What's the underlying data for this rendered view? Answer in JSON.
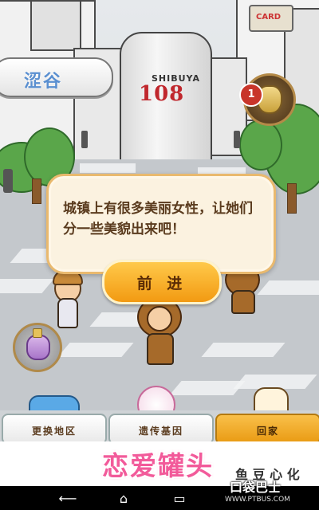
{
  "location": {
    "area_name": "涩谷"
  },
  "scene": {
    "tower_subtitle": "SHIBUYA",
    "tower_number": "108",
    "sign_text": "CARD"
  },
  "item": {
    "count": "1"
  },
  "dialog": {
    "message": "城镇上有很多美丽女性，让她们分一些美貌出来吧！",
    "next_button": "前 进"
  },
  "menu": [
    {
      "label": "更换地区"
    },
    {
      "label": "遗传基因"
    },
    {
      "label": "回家"
    }
  ],
  "ad": {
    "title": "恋爱罐头",
    "side_text": "鱼 豆 心 化"
  },
  "watermark": {
    "brand": "口袋巴士",
    "url": "WWW.PTBUS.COM"
  },
  "colors": {
    "accent": "#f29a12",
    "dialog_border": "#e9b96e",
    "area_text": "#5a8fd0",
    "ad_pink": "#f25a9a"
  }
}
